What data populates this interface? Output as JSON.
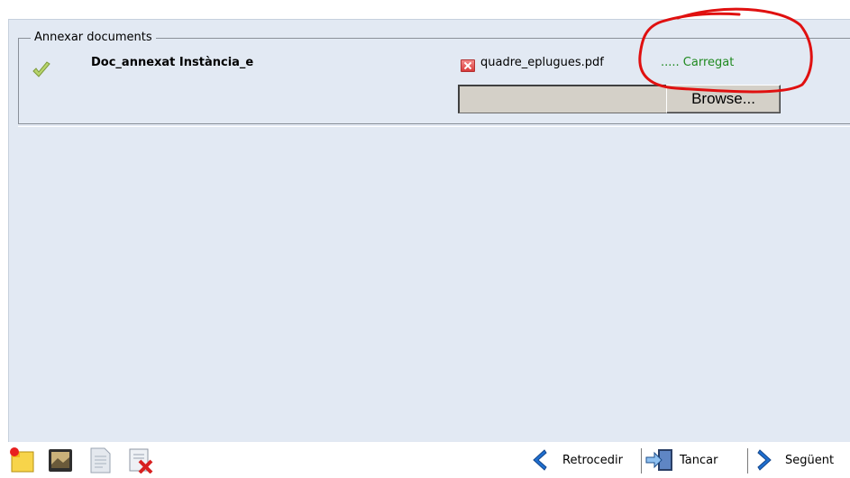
{
  "fieldset": {
    "legend": "Annexar documents",
    "document_label": "Doc_annexat Instància_e",
    "file_name": "quadre_eplugues.pdf",
    "status": "..... Carregat",
    "browse_label": "Browse..."
  },
  "toolbar": {
    "icons": [
      "new-document-icon",
      "image-icon",
      "page-icon",
      "form-delete-icon"
    ],
    "back_label": "Retrocedir",
    "close_label": "Tancar",
    "next_label": "Següent"
  },
  "colors": {
    "panel_bg": "#e2e9f3",
    "status_green": "#208a20",
    "annotation_red": "#e01010",
    "nav_arrow_blue": "#1f6fd0"
  }
}
